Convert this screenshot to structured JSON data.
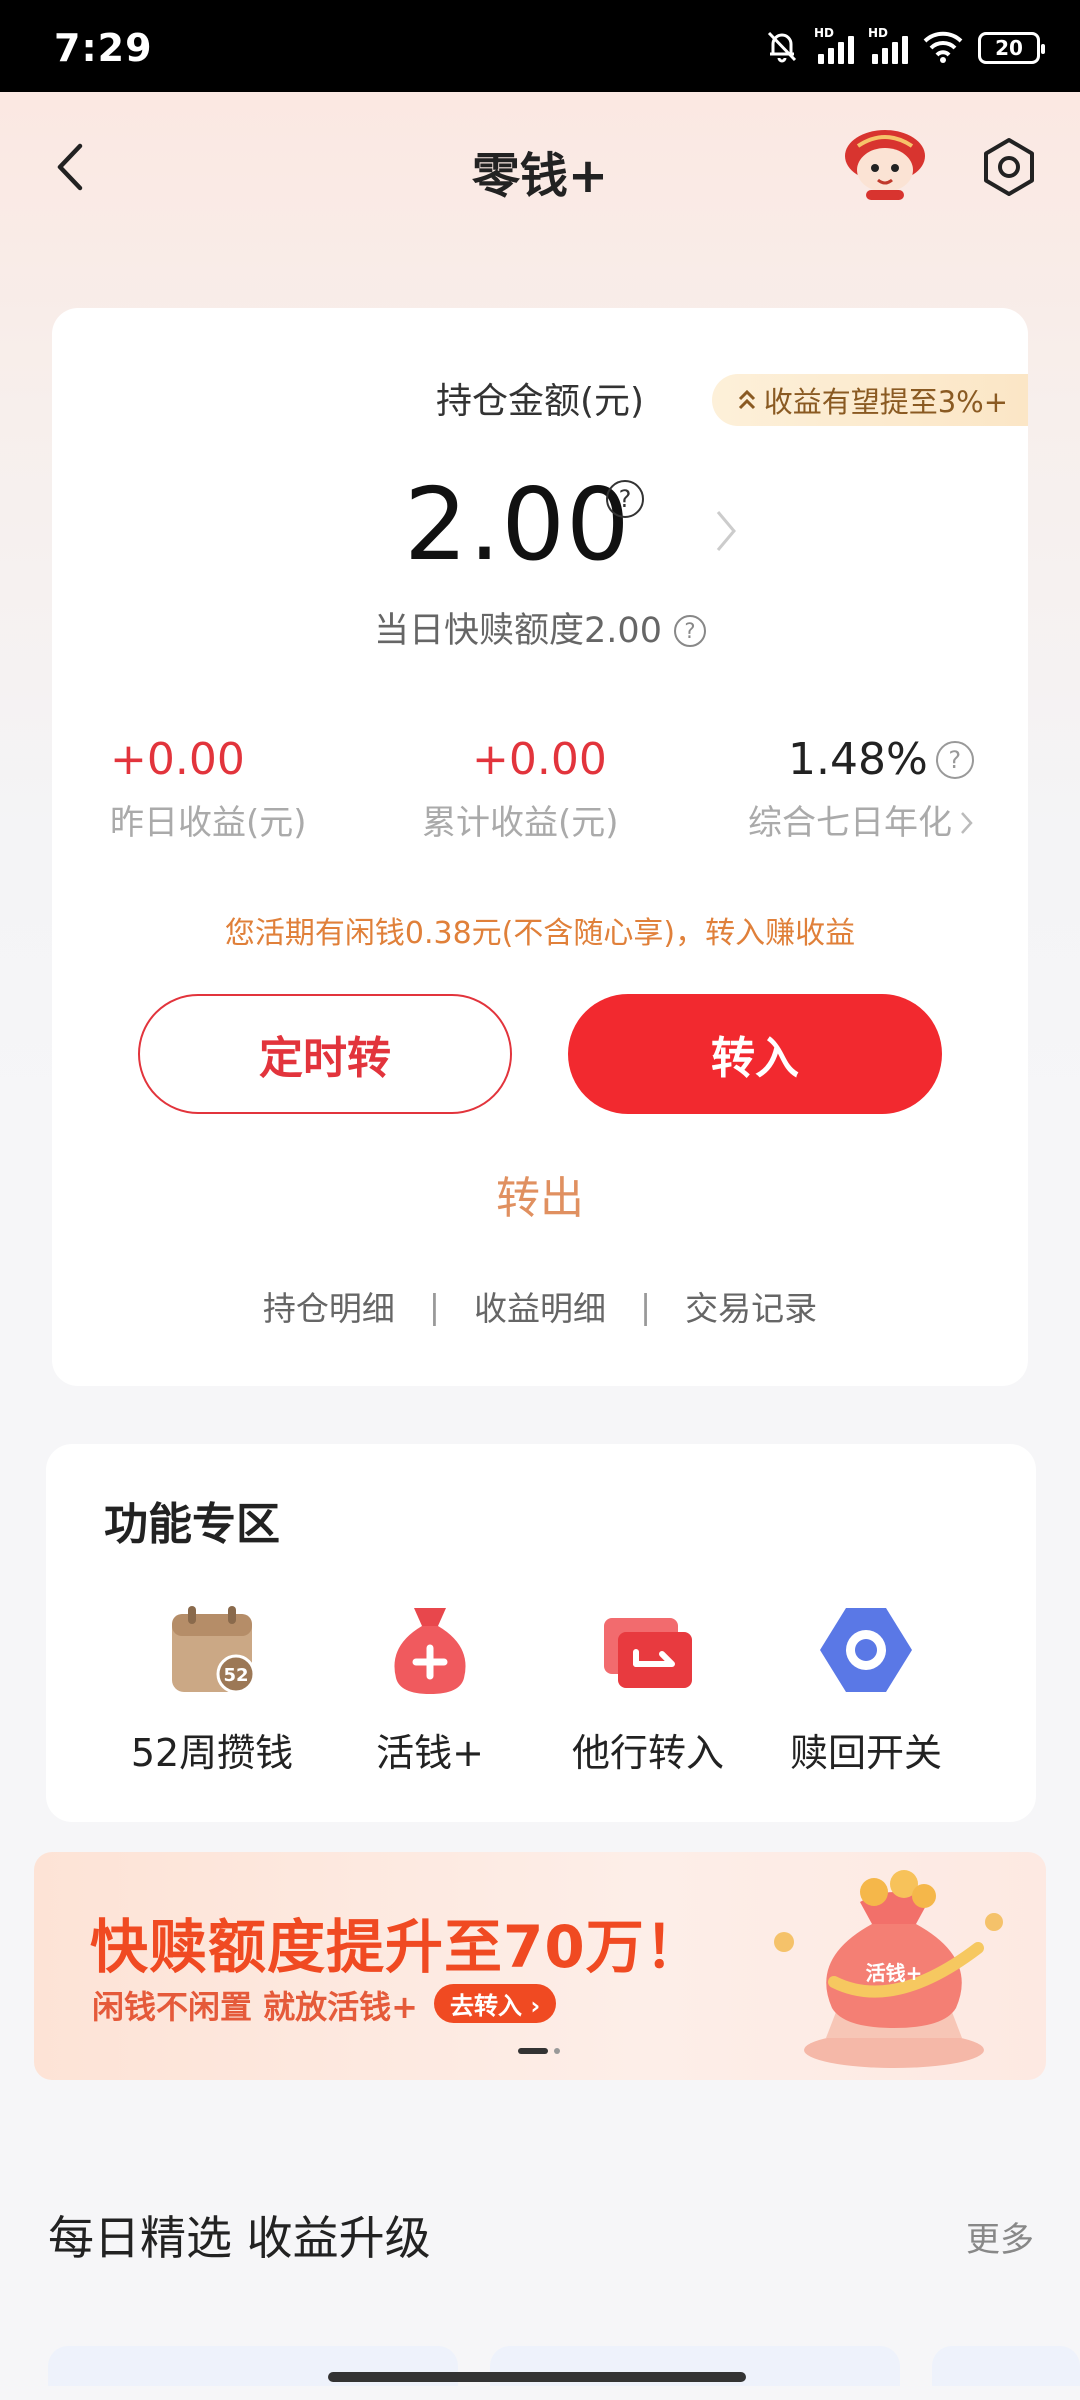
{
  "status_bar": {
    "time": "7:29",
    "battery": "20",
    "icons": [
      "bell-muted-icon",
      "hd-signal-icon",
      "hd-signal-icon",
      "wifi-icon",
      "battery-icon"
    ]
  },
  "header": {
    "title": "零钱+"
  },
  "balance_card": {
    "holding_label": "持仓金额(元)",
    "yield_tag": "收益有望提至3%+",
    "amount": "2.00",
    "quick_redeem_quota": "当日快赎额度2.00",
    "stats": [
      {
        "value": "+0.00",
        "label": "昨日收益(元)"
      },
      {
        "value": "+0.00",
        "label": "累计收益(元)"
      },
      {
        "value": "1.48%",
        "label": "综合七日年化"
      }
    ],
    "idle_tip": "您活期有闲钱0.38元(不含随心享)，转入赚收益",
    "timed_transfer_label": "定时转",
    "transfer_in_label": "转入",
    "transfer_out_label": "转出",
    "links": [
      "持仓明细",
      "收益明细",
      "交易记录"
    ],
    "link_separator": "|"
  },
  "function_area": {
    "title": "功能专区",
    "items": [
      {
        "label": "52周攒钱",
        "icon": "calendar-52-icon",
        "badge": "52"
      },
      {
        "label": "活钱+",
        "icon": "money-bag-plus-icon"
      },
      {
        "label": "他行转入",
        "icon": "bank-transfer-icon"
      },
      {
        "label": "赎回开关",
        "icon": "redeem-switch-icon"
      }
    ]
  },
  "banner": {
    "title": "快赎额度提升至70万！",
    "subtitle": "闲钱不闲置 就放活钱+",
    "cta": "去转入",
    "art_label": "活钱+"
  },
  "daily_picks": {
    "title": "每日精选 收益升级",
    "more": "更多"
  },
  "colors": {
    "accent_red": "#f2292f",
    "profit_red": "#e2343c",
    "tip_orange": "#e0803a",
    "banner_orange": "#f04a22"
  }
}
